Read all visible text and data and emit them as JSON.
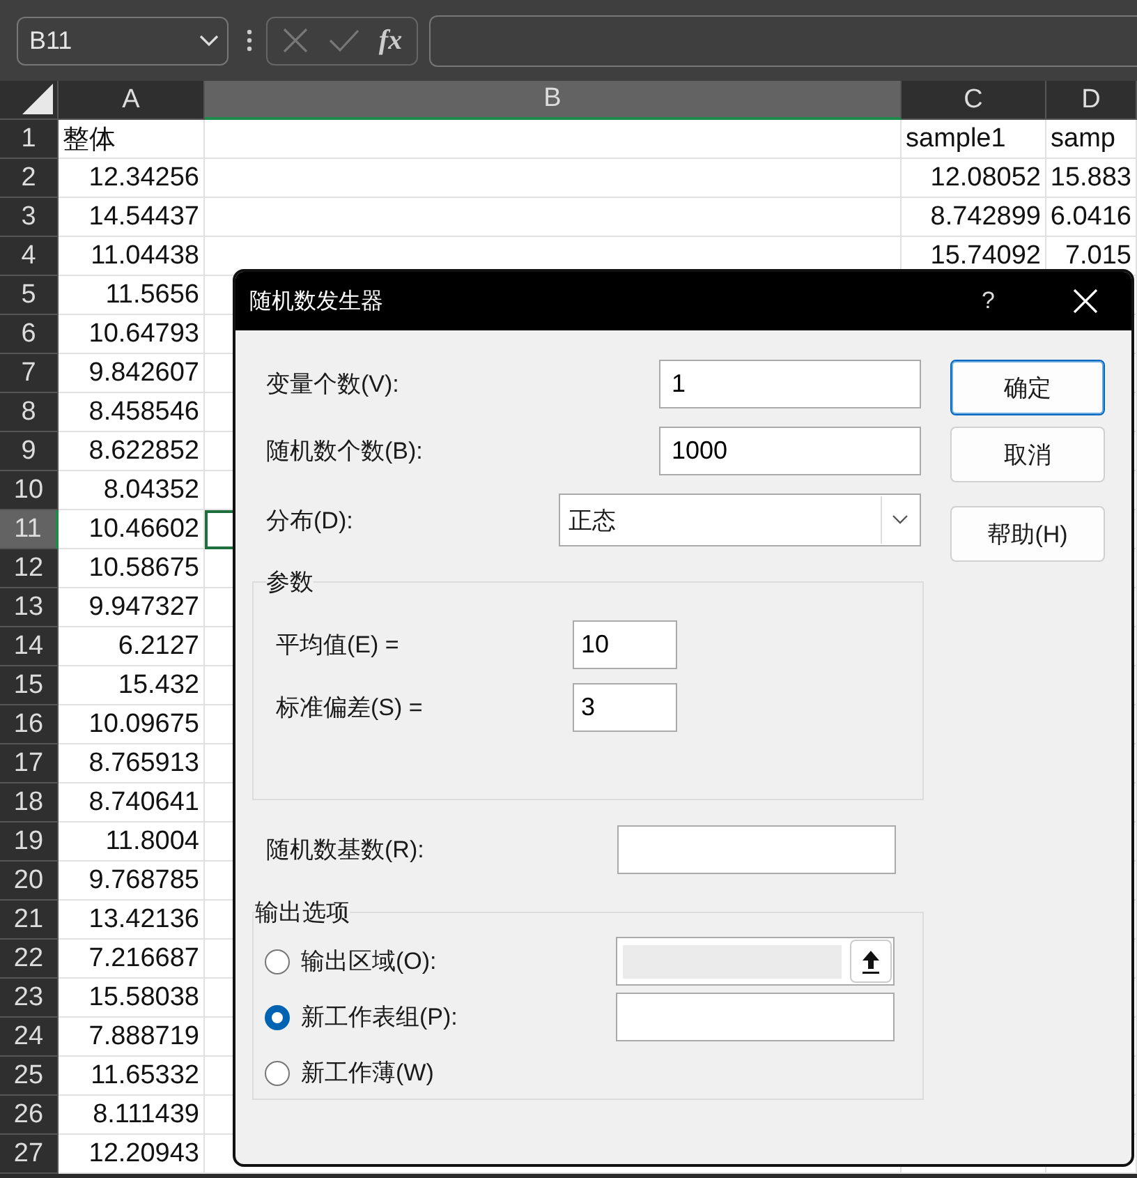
{
  "name_box": {
    "value": "B11"
  },
  "formula_bar": {
    "function_label": "fx"
  },
  "sheet": {
    "columns": [
      {
        "label": "A",
        "selected": false
      },
      {
        "label": "B",
        "selected": true
      },
      {
        "label": "C",
        "selected": false
      },
      {
        "label": "D",
        "selected": false
      }
    ],
    "rows": [
      {
        "number": "1",
        "selected": false,
        "cells": {
          "A": "整体",
          "C": "sample1",
          "D": "samp"
        }
      },
      {
        "number": "2",
        "selected": false,
        "cells": {
          "A": "12.34256",
          "C": "12.08052",
          "D": "15.883"
        }
      },
      {
        "number": "3",
        "selected": false,
        "cells": {
          "A": "14.54437",
          "C": "8.742899",
          "D": "6.0416"
        }
      },
      {
        "number": "4",
        "selected": false,
        "cells": {
          "A": "11.04438",
          "C": "15.74092",
          "D": "7.015"
        }
      },
      {
        "number": "5",
        "selected": false,
        "cells": {
          "A": "11.5656"
        }
      },
      {
        "number": "6",
        "selected": false,
        "cells": {
          "A": "10.64793"
        }
      },
      {
        "number": "7",
        "selected": false,
        "cells": {
          "A": "9.842607"
        }
      },
      {
        "number": "8",
        "selected": false,
        "cells": {
          "A": "8.458546"
        }
      },
      {
        "number": "9",
        "selected": false,
        "cells": {
          "A": "8.622852"
        }
      },
      {
        "number": "10",
        "selected": false,
        "cells": {
          "A": "8.04352"
        }
      },
      {
        "number": "11",
        "selected": true,
        "cells": {
          "A": "10.46602"
        }
      },
      {
        "number": "12",
        "selected": false,
        "cells": {
          "A": "10.58675"
        }
      },
      {
        "number": "13",
        "selected": false,
        "cells": {
          "A": "9.947327"
        }
      },
      {
        "number": "14",
        "selected": false,
        "cells": {
          "A": "6.2127"
        }
      },
      {
        "number": "15",
        "selected": false,
        "cells": {
          "A": "15.432"
        }
      },
      {
        "number": "16",
        "selected": false,
        "cells": {
          "A": "10.09675"
        }
      },
      {
        "number": "17",
        "selected": false,
        "cells": {
          "A": "8.765913"
        }
      },
      {
        "number": "18",
        "selected": false,
        "cells": {
          "A": "8.740641"
        }
      },
      {
        "number": "19",
        "selected": false,
        "cells": {
          "A": "11.8004"
        }
      },
      {
        "number": "20",
        "selected": false,
        "cells": {
          "A": "9.768785"
        }
      },
      {
        "number": "21",
        "selected": false,
        "cells": {
          "A": "13.42136"
        }
      },
      {
        "number": "22",
        "selected": false,
        "cells": {
          "A": "7.216687"
        }
      },
      {
        "number": "23",
        "selected": false,
        "cells": {
          "A": "15.58038"
        }
      },
      {
        "number": "24",
        "selected": false,
        "cells": {
          "A": "7.888719"
        }
      },
      {
        "number": "25",
        "selected": false,
        "cells": {
          "A": "11.65332"
        }
      },
      {
        "number": "26",
        "selected": false,
        "cells": {
          "A": "8.111439"
        }
      },
      {
        "number": "27",
        "selected": false,
        "cells": {
          "A": "12.20943"
        }
      }
    ]
  },
  "dialog": {
    "title": "随机数发生器",
    "help": "?",
    "fields": [
      {
        "label": "变量个数(V):",
        "value": "1"
      },
      {
        "label": "随机数个数(B):",
        "value": "1000"
      }
    ],
    "distribution": {
      "label": "分布(D):",
      "value": "正态"
    },
    "buttons": [
      {
        "label": "确定",
        "default": true
      },
      {
        "label": "取消",
        "default": false
      },
      {
        "label": "帮助(H)",
        "default": false
      }
    ],
    "parameters": {
      "title": "参数",
      "fields": [
        {
          "label": "平均值(E) =",
          "value": "10"
        },
        {
          "label": "标准偏差(S) =",
          "value": "3"
        }
      ]
    },
    "seed": {
      "label": "随机数基数(R):"
    },
    "output": {
      "title": "输出选项",
      "options": [
        {
          "label": "输出区域(O):",
          "selected": false,
          "kind": "range"
        },
        {
          "label": "新工作表组(P):",
          "selected": true,
          "kind": "text"
        },
        {
          "label": "新工作薄(W)",
          "selected": false,
          "kind": "none"
        }
      ]
    }
  }
}
